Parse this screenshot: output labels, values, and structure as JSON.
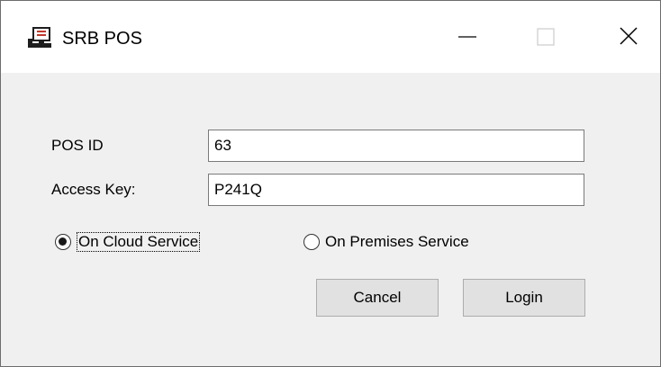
{
  "window": {
    "title": "SRB POS",
    "app_icon": "pos-terminal-icon",
    "controls": {
      "minimize_icon": "minimize-icon",
      "maximize_icon": "maximize-icon",
      "close_icon": "close-icon"
    }
  },
  "form": {
    "pos_id": {
      "label": "POS ID",
      "value": "63"
    },
    "access_key": {
      "label": "Access Key:",
      "value": "P241Q"
    },
    "service": {
      "options": [
        {
          "label": "On Cloud Service",
          "selected": true
        },
        {
          "label": "On Premises Service",
          "selected": false
        }
      ]
    },
    "buttons": {
      "cancel": "Cancel",
      "login": "Login"
    }
  },
  "colors": {
    "window_bg": "#f0f0f0",
    "titlebar_bg": "#ffffff",
    "button_bg": "#e1e1e1",
    "button_border": "#adadad",
    "field_border": "#7a7a7a",
    "icon_red": "#c0392b"
  }
}
